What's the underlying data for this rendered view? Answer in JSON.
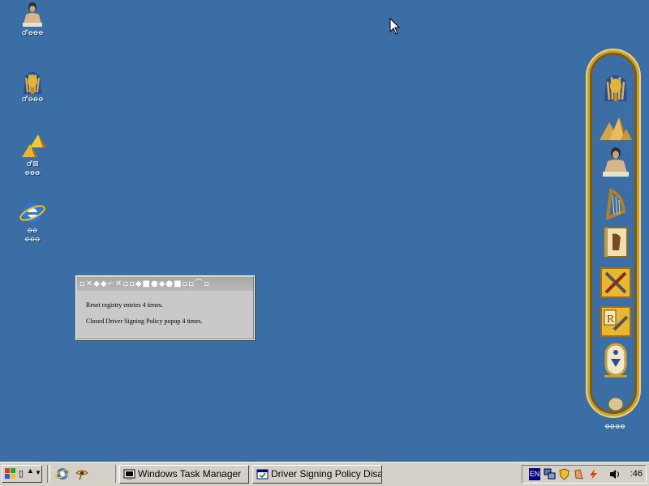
{
  "desktop": {
    "icons": [
      {
        "name": "scribe-statue",
        "label": "♂ꝋꝋꝋ"
      },
      {
        "name": "pharaoh-mask",
        "label": "♂ꝋꝋꝋ"
      },
      {
        "name": "pyramids",
        "label": "♂⊠\nꝋꝋꝋ"
      },
      {
        "name": "internet-explorer",
        "label": "ꝋꝋ\nꝋꝋꝋ"
      }
    ]
  },
  "popup": {
    "title": "▫✕◆◆⌐✕▫▫◆■●◆●■▫▫⌒▫",
    "lines": [
      "Reset registry entries 4 times.",
      "Closed Driver Signing Policy popup 4 times."
    ]
  },
  "dock": {
    "items": [
      "pharaoh-mask-icon",
      "pyramids-icon",
      "scribe-statue-icon",
      "harp-icon",
      "papyrus-book-icon",
      "tools-icon",
      "repair-tools-icon",
      "cartouche-icon"
    ],
    "bottom_label": "ꝋꝋꝋꝋ"
  },
  "taskbar": {
    "start_label": "▯",
    "tasks": [
      {
        "label": "Windows Task Manager"
      },
      {
        "label": "Driver Signing Policy Disa..."
      }
    ],
    "tray": {
      "lang": "EN",
      "clock": ":46"
    }
  },
  "colors": {
    "desktop": "#3a6ea5",
    "taskbar": "#d4d0c8",
    "dock_gold": "#c9a233"
  }
}
